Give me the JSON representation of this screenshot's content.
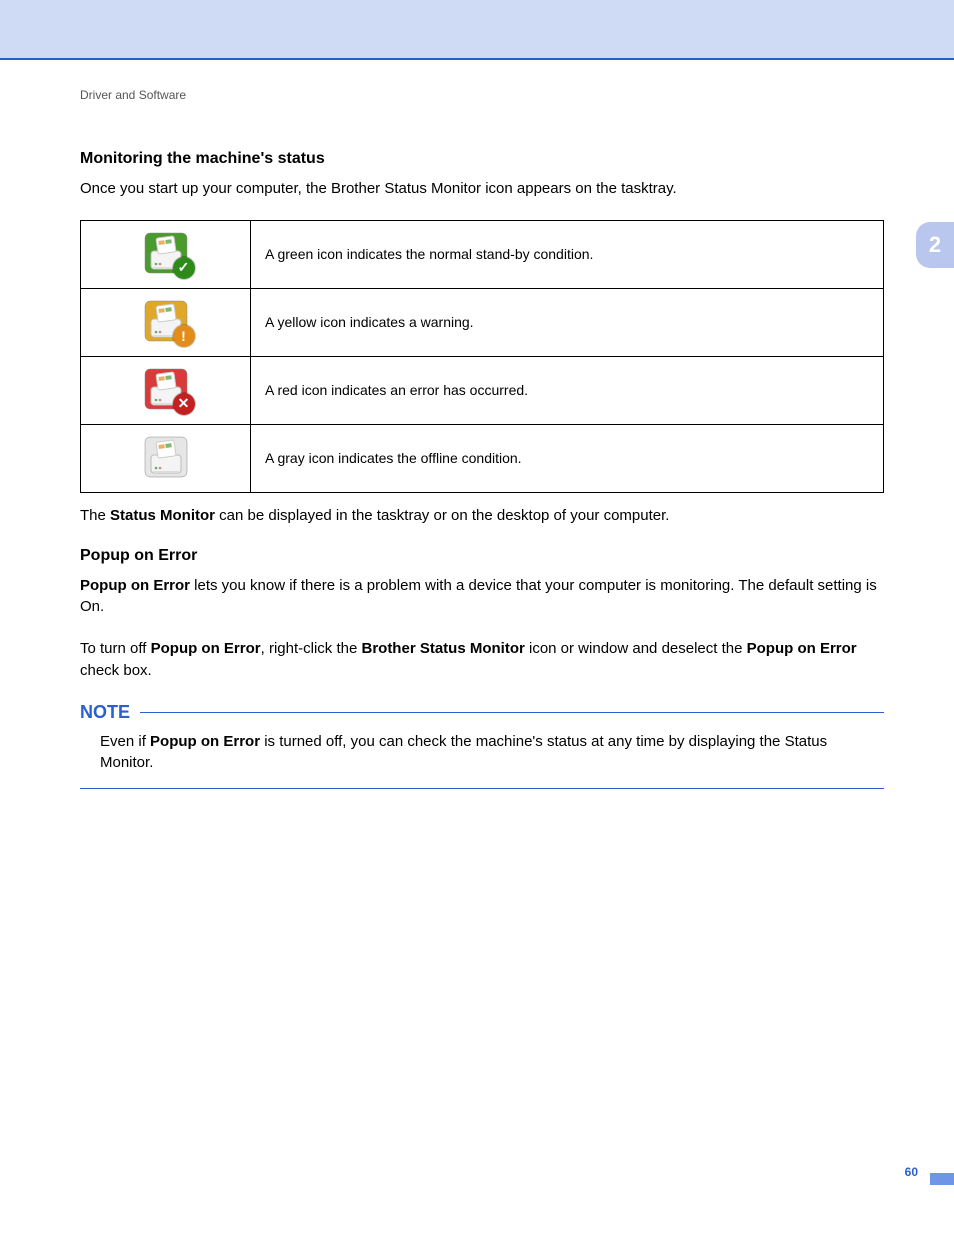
{
  "breadcrumb": "Driver and Software",
  "chapter_tab": "2",
  "page_number": "60",
  "section1": {
    "heading": "Monitoring the machine's status",
    "intro": "Once you start up your computer, the Brother Status Monitor icon appears on the tasktray.",
    "rows": [
      {
        "bg": "#4a9b2e",
        "badge_bg": "#2e8b1a",
        "badge_glyph": "✓",
        "desc": "A green icon indicates the normal stand-by condition."
      },
      {
        "bg": "#e0a82a",
        "badge_bg": "#e28c1a",
        "badge_glyph": "!",
        "desc": "A yellow icon indicates a warning."
      },
      {
        "bg": "#d93a3a",
        "badge_bg": "#c42020",
        "badge_glyph": "✕",
        "desc": "A red icon indicates an error has occurred."
      },
      {
        "bg": "#e6e6e6",
        "badge_bg": "",
        "badge_glyph": "",
        "desc": "A gray icon indicates the offline condition."
      }
    ],
    "outro_pre": "The ",
    "outro_bold": "Status Monitor",
    "outro_post": " can be displayed in the tasktray or on the desktop of your computer."
  },
  "section2": {
    "heading": "Popup on Error",
    "p1_bold": "Popup on Error",
    "p1_tail": " lets you know if there is a problem with a device that your computer is monitoring. The default setting is On.",
    "p2_pre": "To turn off ",
    "p2_b1": "Popup on Error",
    "p2_mid": ", right-click the ",
    "p2_b2": "Brother Status Monitor",
    "p2_mid2": " icon or window and deselect the ",
    "p2_b3": "Popup on Error",
    "p2_tail": " check box."
  },
  "note": {
    "label": "NOTE",
    "body_pre": "Even if ",
    "body_bold": "Popup on Error",
    "body_post": " is turned off, you can check the machine's status at any time by displaying the Status Monitor."
  }
}
